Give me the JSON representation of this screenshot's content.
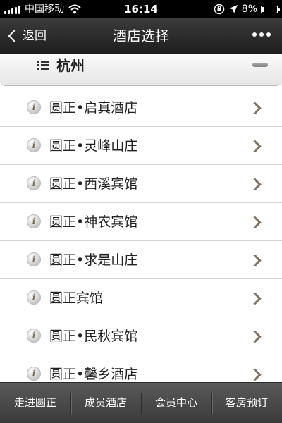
{
  "status_bar": {
    "carrier": "中国移动",
    "time": "16:14",
    "battery_percent": "8%",
    "battery_level": 0.08,
    "icons": [
      "signal-icon",
      "wifi-icon",
      "rotation-lock-icon",
      "location-arrow-icon",
      "battery-icon"
    ]
  },
  "nav": {
    "back_label": "返回",
    "title": "酒店选择",
    "more_icon": "more-dots-icon"
  },
  "section": {
    "title": "杭州",
    "icon": "list-icon",
    "collapse_icon": "collapse-bar-icon"
  },
  "hotels": [
    {
      "name": "圆正•启真酒店"
    },
    {
      "name": "圆正•灵峰山庄"
    },
    {
      "name": "圆正•西溪宾馆"
    },
    {
      "name": "圆正•神农宾馆"
    },
    {
      "name": "圆正•求是山庄"
    },
    {
      "name": "圆正宾馆"
    },
    {
      "name": "圆正•民秋宾馆"
    },
    {
      "name": "圆正•馨乡酒店"
    }
  ],
  "item_icon": "info-icon",
  "item_chevron": "chevron-right-icon",
  "tabs": [
    {
      "label": "走进圆正"
    },
    {
      "label": "成员酒店"
    },
    {
      "label": "会员中心"
    },
    {
      "label": "客房预订"
    }
  ],
  "colors": {
    "nav_bg": "#2b2b2b",
    "tab_bg": "#4a4a4a",
    "chevron": "#7f6f5c"
  }
}
